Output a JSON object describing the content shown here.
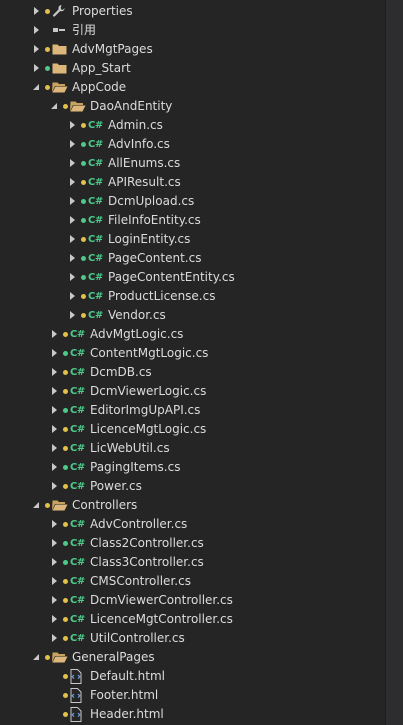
{
  "explorer": {
    "items": [
      {
        "label": "Properties",
        "icon": "wrench-icon",
        "expander": "collapsed",
        "status": "yellow",
        "depth": 0
      },
      {
        "label": "引用",
        "icon": "reference-icon",
        "expander": "collapsed",
        "status": "none",
        "depth": 0
      },
      {
        "label": "AdvMgtPages",
        "icon": "folder-icon",
        "expander": "collapsed",
        "status": "yellow",
        "depth": 0
      },
      {
        "label": "App_Start",
        "icon": "folder-icon",
        "expander": "collapsed",
        "status": "green",
        "depth": 0
      },
      {
        "label": "AppCode",
        "icon": "folder-open-icon",
        "expander": "expanded",
        "status": "yellow",
        "depth": 0
      },
      {
        "label": "DaoAndEntity",
        "icon": "folder-open-icon",
        "expander": "expanded",
        "status": "yellow",
        "depth": 1
      },
      {
        "label": "Admin.cs",
        "icon": "csharp-file-icon",
        "expander": "collapsed",
        "status": "yellow",
        "depth": 2
      },
      {
        "label": "AdvInfo.cs",
        "icon": "csharp-file-icon",
        "expander": "collapsed",
        "status": "green",
        "depth": 2
      },
      {
        "label": "AllEnums.cs",
        "icon": "csharp-file-icon",
        "expander": "collapsed",
        "status": "green",
        "depth": 2
      },
      {
        "label": "APIResult.cs",
        "icon": "csharp-file-icon",
        "expander": "collapsed",
        "status": "yellow",
        "depth": 2
      },
      {
        "label": "DcmUpload.cs",
        "icon": "csharp-file-icon",
        "expander": "collapsed",
        "status": "green",
        "depth": 2
      },
      {
        "label": "FileInfoEntity.cs",
        "icon": "csharp-file-icon",
        "expander": "collapsed",
        "status": "green",
        "depth": 2
      },
      {
        "label": "LoginEntity.cs",
        "icon": "csharp-file-icon",
        "expander": "collapsed",
        "status": "yellow",
        "depth": 2
      },
      {
        "label": "PageContent.cs",
        "icon": "csharp-file-icon",
        "expander": "collapsed",
        "status": "green",
        "depth": 2
      },
      {
        "label": "PageContentEntity.cs",
        "icon": "csharp-file-icon",
        "expander": "collapsed",
        "status": "green",
        "depth": 2
      },
      {
        "label": "ProductLicense.cs",
        "icon": "csharp-file-icon",
        "expander": "collapsed",
        "status": "yellow",
        "depth": 2
      },
      {
        "label": "Vendor.cs",
        "icon": "csharp-file-icon",
        "expander": "collapsed",
        "status": "yellow",
        "depth": 2
      },
      {
        "label": "AdvMgtLogic.cs",
        "icon": "csharp-file-icon",
        "expander": "collapsed",
        "status": "yellow",
        "depth": 1
      },
      {
        "label": "ContentMgtLogic.cs",
        "icon": "csharp-file-icon",
        "expander": "collapsed",
        "status": "green",
        "depth": 1
      },
      {
        "label": "DcmDB.cs",
        "icon": "csharp-file-icon",
        "expander": "collapsed",
        "status": "yellow",
        "depth": 1
      },
      {
        "label": "DcmViewerLogic.cs",
        "icon": "csharp-file-icon",
        "expander": "collapsed",
        "status": "yellow",
        "depth": 1
      },
      {
        "label": "EditorImgUpAPI.cs",
        "icon": "csharp-file-icon",
        "expander": "collapsed",
        "status": "green",
        "depth": 1
      },
      {
        "label": "LicenceMgtLogic.cs",
        "icon": "csharp-file-icon",
        "expander": "collapsed",
        "status": "yellow",
        "depth": 1
      },
      {
        "label": "LicWebUtil.cs",
        "icon": "csharp-file-icon",
        "expander": "collapsed",
        "status": "yellow",
        "depth": 1
      },
      {
        "label": "PagingItems.cs",
        "icon": "csharp-file-icon",
        "expander": "collapsed",
        "status": "green",
        "depth": 1
      },
      {
        "label": "Power.cs",
        "icon": "csharp-file-icon",
        "expander": "collapsed",
        "status": "yellow",
        "depth": 1
      },
      {
        "label": "Controllers",
        "icon": "folder-open-icon",
        "expander": "expanded",
        "status": "yellow",
        "depth": 0
      },
      {
        "label": "AdvController.cs",
        "icon": "csharp-file-icon",
        "expander": "collapsed",
        "status": "yellow",
        "depth": 1
      },
      {
        "label": "Class2Controller.cs",
        "icon": "csharp-file-icon",
        "expander": "collapsed",
        "status": "green",
        "depth": 1
      },
      {
        "label": "Class3Controller.cs",
        "icon": "csharp-file-icon",
        "expander": "collapsed",
        "status": "green",
        "depth": 1
      },
      {
        "label": "CMSController.cs",
        "icon": "csharp-file-icon",
        "expander": "collapsed",
        "status": "yellow",
        "depth": 1
      },
      {
        "label": "DcmViewerController.cs",
        "icon": "csharp-file-icon",
        "expander": "collapsed",
        "status": "yellow",
        "depth": 1
      },
      {
        "label": "LicenceMgtController.cs",
        "icon": "csharp-file-icon",
        "expander": "collapsed",
        "status": "yellow",
        "depth": 1
      },
      {
        "label": "UtilController.cs",
        "icon": "csharp-file-icon",
        "expander": "collapsed",
        "status": "yellow",
        "depth": 1
      },
      {
        "label": "GeneralPages",
        "icon": "folder-open-icon",
        "expander": "expanded",
        "status": "yellow",
        "depth": 0
      },
      {
        "label": "Default.html",
        "icon": "html-file-icon",
        "expander": "none",
        "status": "yellow",
        "depth": 1
      },
      {
        "label": "Footer.html",
        "icon": "html-file-icon",
        "expander": "none",
        "status": "yellow",
        "depth": 1
      },
      {
        "label": "Header.html",
        "icon": "html-file-icon",
        "expander": "none",
        "status": "yellow",
        "depth": 1
      }
    ]
  },
  "icons": {
    "csharp_glyph": "C#"
  },
  "colors": {
    "background": "#252526",
    "text": "#dcdcdc",
    "status_yellow": "#e2c04a",
    "status_green": "#4ec98a",
    "folder": "#dcb67a",
    "csharp": "#4ec98a"
  }
}
